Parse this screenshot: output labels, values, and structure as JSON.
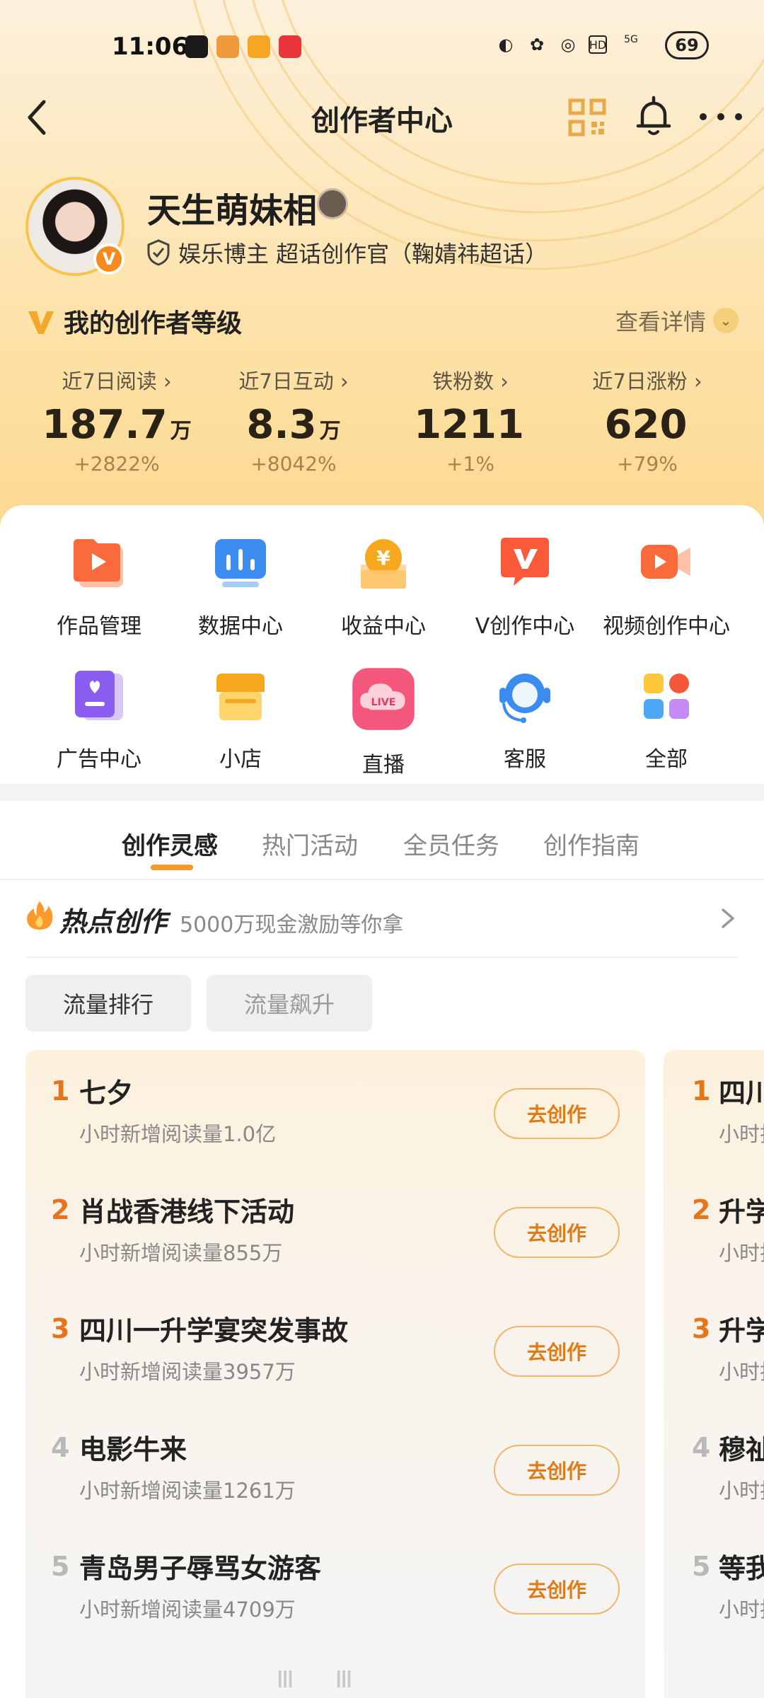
{
  "status_bar": {
    "time": "11:06",
    "network": "5G",
    "battery": "69",
    "app_colors": [
      "#1a1a1a",
      "#f09a3e",
      "#f5a623",
      "#e8353b"
    ]
  },
  "nav": {
    "title": "创作者中心"
  },
  "profile": {
    "name": "天生萌妹相",
    "verified_mark": "V",
    "description": "娱乐博主 超话创作官（鞠婧祎超话）"
  },
  "level": {
    "title": "我的创作者等级",
    "detail_link": "查看详情"
  },
  "stats": [
    {
      "label": "近7日阅读 ›",
      "value": "187.7",
      "unit": "万",
      "change": "+2822%"
    },
    {
      "label": "近7日互动 ›",
      "value": "8.3",
      "unit": "万",
      "change": "+8042%"
    },
    {
      "label": "铁粉数 ›",
      "value": "1211",
      "unit": "",
      "change": "+1%"
    },
    {
      "label": "近7日涨粉 ›",
      "value": "620",
      "unit": "",
      "change": "+79%"
    }
  ],
  "tools": [
    {
      "label": "作品管理",
      "icon": "works-management-icon"
    },
    {
      "label": "数据中心",
      "icon": "data-center-icon"
    },
    {
      "label": "收益中心",
      "icon": "earnings-icon"
    },
    {
      "label": "V创作中心",
      "icon": "v-creation-icon"
    },
    {
      "label": "视频创作中心",
      "icon": "video-creation-icon"
    },
    {
      "label": "广告中心",
      "icon": "ad-center-icon"
    },
    {
      "label": "小店",
      "icon": "shop-icon"
    },
    {
      "label": "直播",
      "icon": "live-icon",
      "badge": "LIVE"
    },
    {
      "label": "客服",
      "icon": "customer-service-icon"
    },
    {
      "label": "全部",
      "icon": "all-apps-icon"
    }
  ],
  "tabs": [
    "创作灵感",
    "热门活动",
    "全员任务",
    "创作指南"
  ],
  "active_tab": 0,
  "hot": {
    "title": "热点创作",
    "subtitle": "5000万现金激励等你拿"
  },
  "filters": [
    "流量排行",
    "流量飙升"
  ],
  "rank_left": [
    {
      "rank": "1",
      "title": "七夕",
      "sub": "小时新增阅读量1.0亿",
      "button": "去创作"
    },
    {
      "rank": "2",
      "title": "肖战香港线下活动",
      "sub": "小时新增阅读量855万",
      "button": "去创作"
    },
    {
      "rank": "3",
      "title": "四川一升学宴突发事故",
      "sub": "小时新增阅读量3957万",
      "button": "去创作"
    },
    {
      "rank": "4",
      "title": "电影牛来",
      "sub": "小时新增阅读量1261万",
      "button": "去创作"
    },
    {
      "rank": "5",
      "title": "青岛男子辱骂女游客",
      "sub": "小时新增阅读量4709万",
      "button": "去创作"
    }
  ],
  "rank_right": [
    {
      "rank": "1",
      "title": "四川",
      "sub": "小时抖"
    },
    {
      "rank": "2",
      "title": "升学",
      "sub": "小时抖"
    },
    {
      "rank": "3",
      "title": "升学",
      "sub": "小时抖"
    },
    {
      "rank": "4",
      "title": "穆祉",
      "sub": "小时抖"
    },
    {
      "rank": "5",
      "title": "等我",
      "sub": "小时抖"
    }
  ],
  "colors": {
    "accent_orange": "#f79a2a",
    "rank_top": "#e5741a",
    "rank_other": "#b9b9b9"
  }
}
